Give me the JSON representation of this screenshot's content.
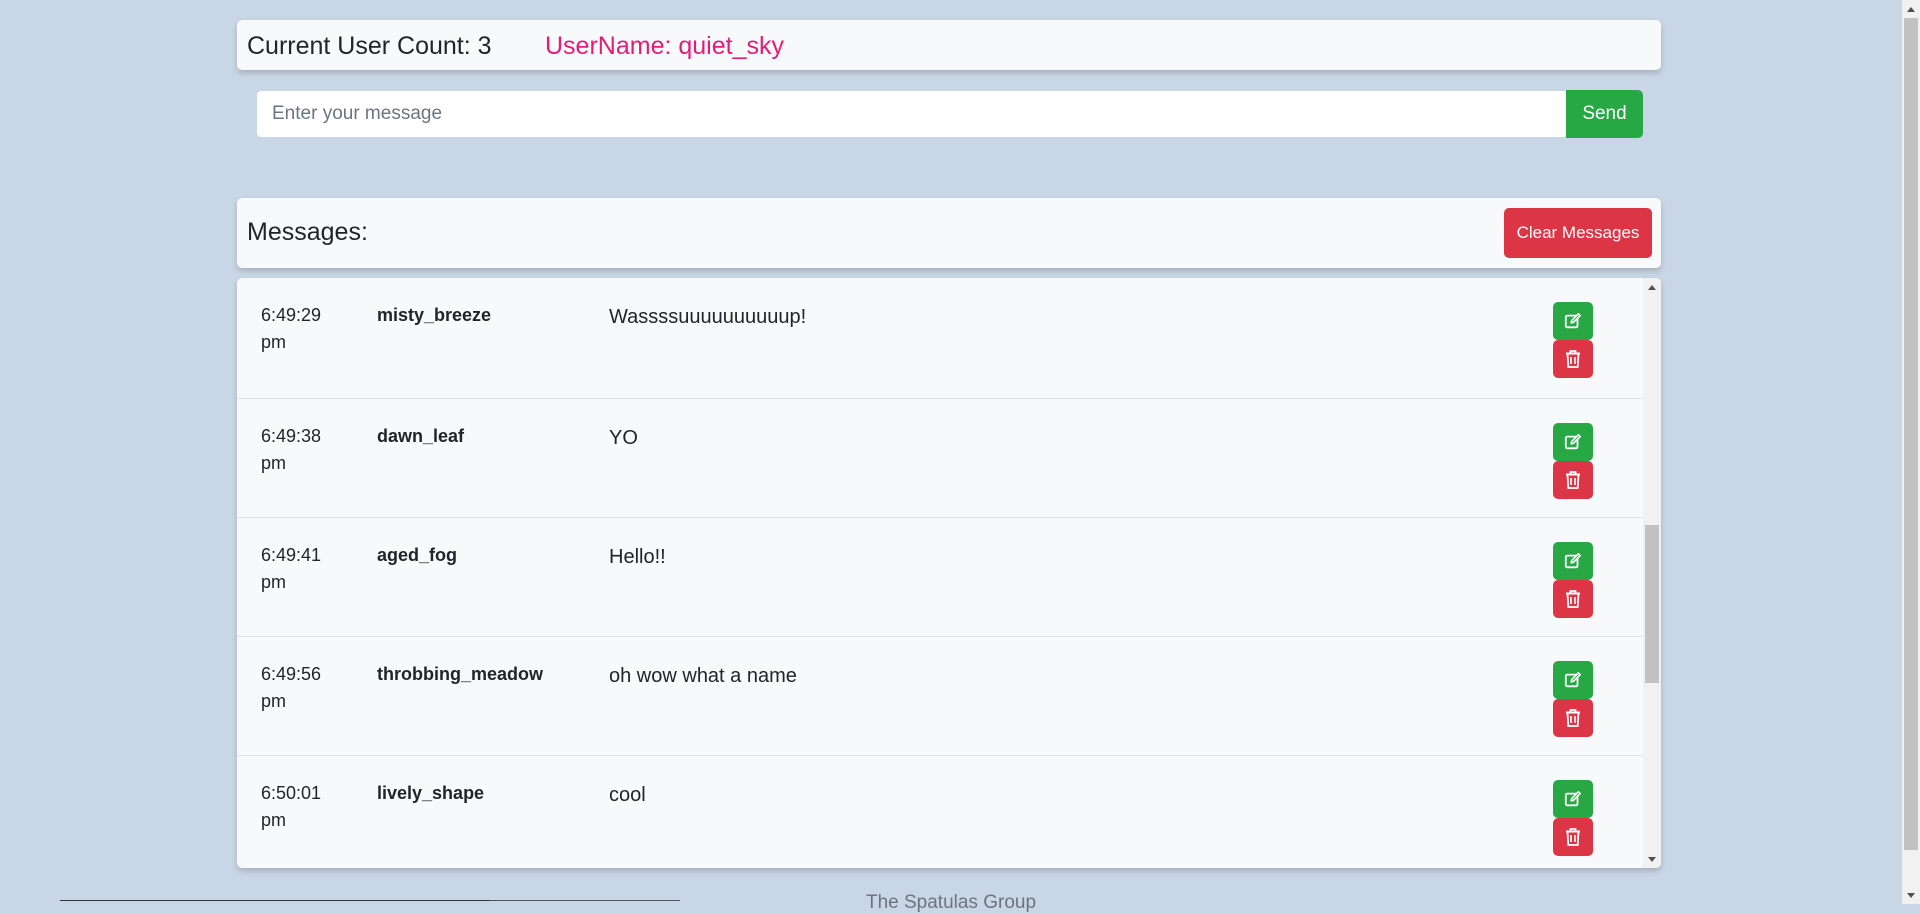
{
  "header": {
    "user_count": "Current User Count: 3",
    "username": "UserName: quiet_sky"
  },
  "composer": {
    "placeholder": "Enter your message",
    "value": "",
    "send_label": "Send"
  },
  "messages_panel": {
    "title": "Messages:",
    "clear_label": "Clear Messages"
  },
  "messages": [
    {
      "time": "6:49:29 pm",
      "author": "misty_breeze",
      "text": "Wassssuuuuuuuuuup!"
    },
    {
      "time": "6:49:38 pm",
      "author": "dawn_leaf",
      "text": "YO"
    },
    {
      "time": "6:49:41 pm",
      "author": "aged_fog",
      "text": "Hello!!"
    },
    {
      "time": "6:49:56 pm",
      "author": "throbbing_meadow",
      "text": "oh wow what a name"
    },
    {
      "time": "6:50:01 pm",
      "author": "lively_shape",
      "text": "cool"
    }
  ],
  "footer": {
    "text": "The Spatulas Group"
  },
  "colors": {
    "background": "#c9d6e5",
    "username": "#e31c7a",
    "success": "#28a745",
    "danger": "#dc3545"
  },
  "icons": {
    "edit": "edit-icon",
    "delete": "trash-icon"
  }
}
